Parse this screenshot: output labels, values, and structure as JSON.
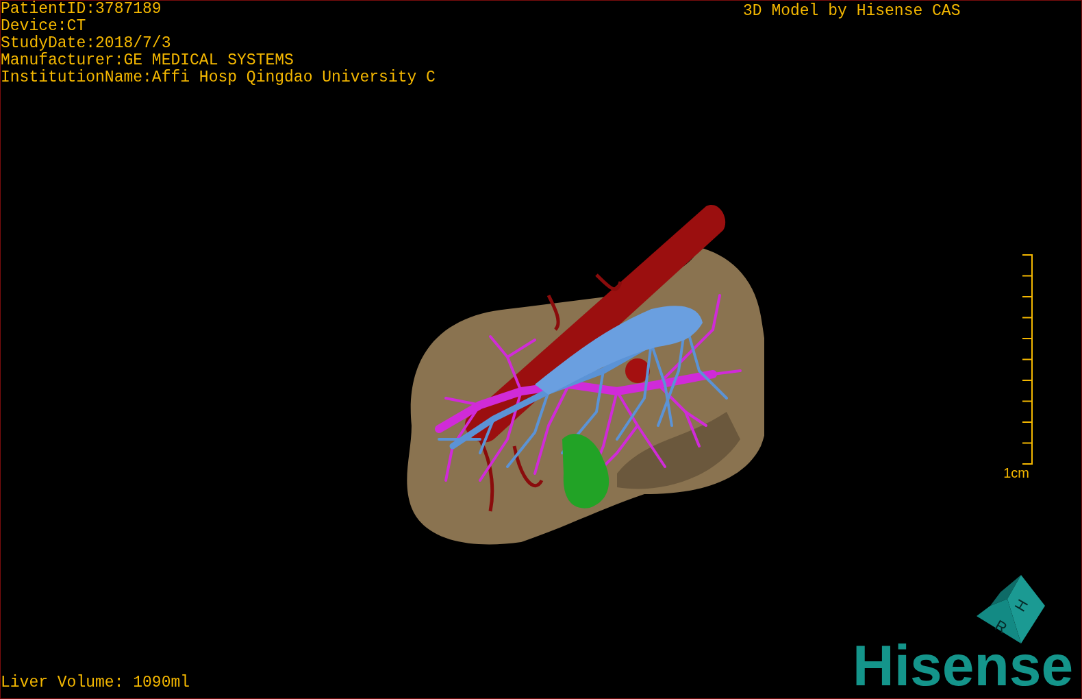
{
  "patient_info": [
    "PatientID:3787189",
    "Device:CT",
    "StudyDate:2018/7/3",
    "Manufacturer:GE MEDICAL SYSTEMS",
    "InstitutionName:Affi Hosp Qingdao University C"
  ],
  "model_credit": "3D Model by Hisense CAS",
  "scale_bar": {
    "label": "1cm"
  },
  "orientation_cube": {
    "faces": [
      "H",
      "R"
    ]
  },
  "logo": "Hisense",
  "liver_volume": "Liver Volume: 1090ml"
}
